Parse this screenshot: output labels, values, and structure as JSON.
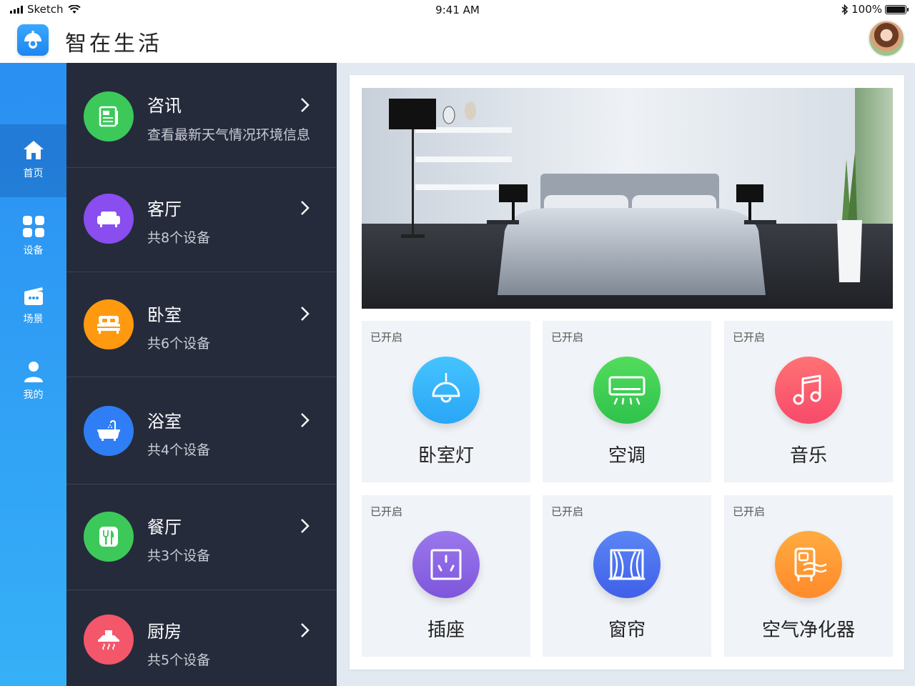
{
  "status_bar": {
    "carrier": "Sketch",
    "time": "9:41 AM",
    "battery": "100%",
    "battery_level": 1.0
  },
  "header": {
    "title": "智在生活",
    "logo_icon": "lamp-icon",
    "avatar": "user-avatar"
  },
  "nav": {
    "items": [
      {
        "label": "首页",
        "icon": "home-icon",
        "active": true
      },
      {
        "label": "设备",
        "icon": "grid-icon",
        "active": false
      },
      {
        "label": "场景",
        "icon": "scene-icon",
        "active": false
      },
      {
        "label": "我的",
        "icon": "person-icon",
        "active": false
      }
    ]
  },
  "rooms": [
    {
      "title": "咨讯",
      "subtitle": "查看最新天气情况环境信息",
      "icon": "news-icon",
      "color": "#3cc95a"
    },
    {
      "title": "客厅",
      "subtitle": "共8个设备",
      "icon": "sofa-icon",
      "color": "#8a4df0"
    },
    {
      "title": "卧室",
      "subtitle": "共6个设备",
      "icon": "bed-icon",
      "color": "#ff9a10"
    },
    {
      "title": "浴室",
      "subtitle": "共4个设备",
      "icon": "bathtub-icon",
      "color": "#2f7ef5"
    },
    {
      "title": "餐厅",
      "subtitle": "共3个设备",
      "icon": "dining-icon",
      "color": "#3cc95a"
    },
    {
      "title": "厨房",
      "subtitle": "共5个设备",
      "icon": "range-hood-icon",
      "color": "#f4566a"
    }
  ],
  "devices": [
    {
      "state": "已开启",
      "label": "卧室灯",
      "icon": "pendant-lamp-icon",
      "color": "#35b6fb"
    },
    {
      "state": "已开启",
      "label": "空调",
      "icon": "air-conditioner-icon",
      "color": "#3fcf55"
    },
    {
      "state": "已开启",
      "label": "音乐",
      "icon": "music-note-icon",
      "color": "#ff5f6d"
    },
    {
      "state": "已开启",
      "label": "插座",
      "icon": "socket-icon",
      "color": "#8e63e6"
    },
    {
      "state": "已开启",
      "label": "窗帘",
      "icon": "curtain-icon",
      "color": "#4f6ff0"
    },
    {
      "state": "已开启",
      "label": "空气净化器",
      "icon": "air-purifier-icon",
      "color": "#ff9a36"
    }
  ]
}
